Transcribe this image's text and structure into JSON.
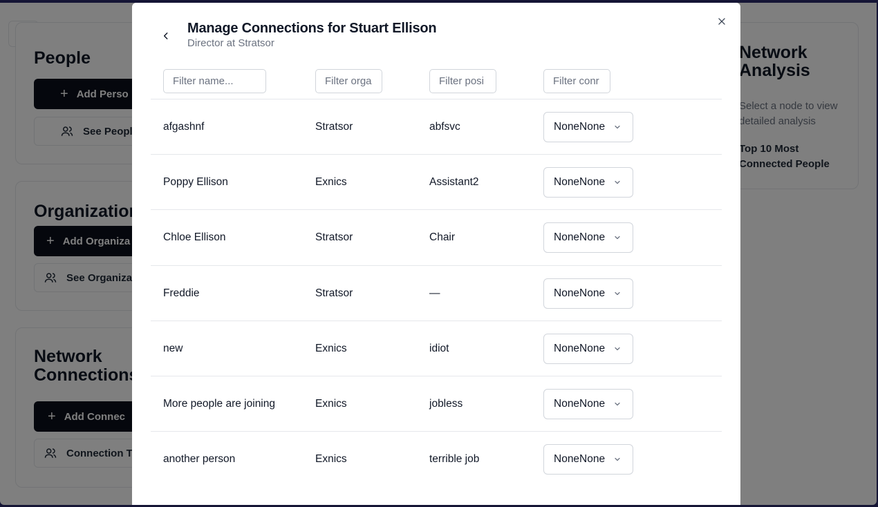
{
  "background": {
    "people": {
      "title": "People",
      "add_label": "Add Perso",
      "see_label": "See Peopl"
    },
    "organizations": {
      "title": "Organization",
      "add_label": "Add Organiza",
      "see_label": "See Organiza"
    },
    "network": {
      "title_line1": "Network",
      "title_line2": "Connections",
      "add_label": "Add Connec",
      "see_label": "Connection T"
    },
    "analysis": {
      "title": "Network Analysis",
      "subtitle": "Select a node to view detailed analysis",
      "top10": "Top 10 Most Connected People"
    }
  },
  "modal": {
    "title": "Manage Connections for Stuart Ellison",
    "subtitle": "Director at Stratsor",
    "filters": {
      "name_placeholder": "Filter name...",
      "org_placeholder": "Filter orga",
      "position_placeholder": "Filter posi",
      "connection_placeholder": "Filter conr"
    },
    "rows": [
      {
        "name": "afgashnf",
        "org": "Stratsor",
        "position": "abfsvc",
        "connection": "NoneNone"
      },
      {
        "name": "Poppy Ellison",
        "org": "Exnics",
        "position": "Assistant2",
        "connection": "NoneNone"
      },
      {
        "name": "Chloe Ellison",
        "org": "Stratsor",
        "position": "Chair",
        "connection": "NoneNone"
      },
      {
        "name": "Freddie",
        "org": "Stratsor",
        "position": "—",
        "connection": "NoneNone"
      },
      {
        "name": "new",
        "org": "Exnics",
        "position": "idiot",
        "connection": "NoneNone"
      },
      {
        "name": "More people are joining",
        "org": "Exnics",
        "position": "jobless",
        "connection": "NoneNone"
      },
      {
        "name": "another person",
        "org": "Exnics",
        "position": "terrible job",
        "connection": "NoneNone"
      }
    ]
  },
  "icons": {
    "home": "home-icon",
    "back": "chevron-left-icon",
    "close": "close-icon",
    "chevron": "chevron-down-icon",
    "users": "users-icon",
    "plus": "plus-icon"
  },
  "colors": {
    "window_border": "#2a2b6b",
    "dark_button": "#0b0f1a",
    "overlay": "rgba(0,0,0,0.5)"
  }
}
